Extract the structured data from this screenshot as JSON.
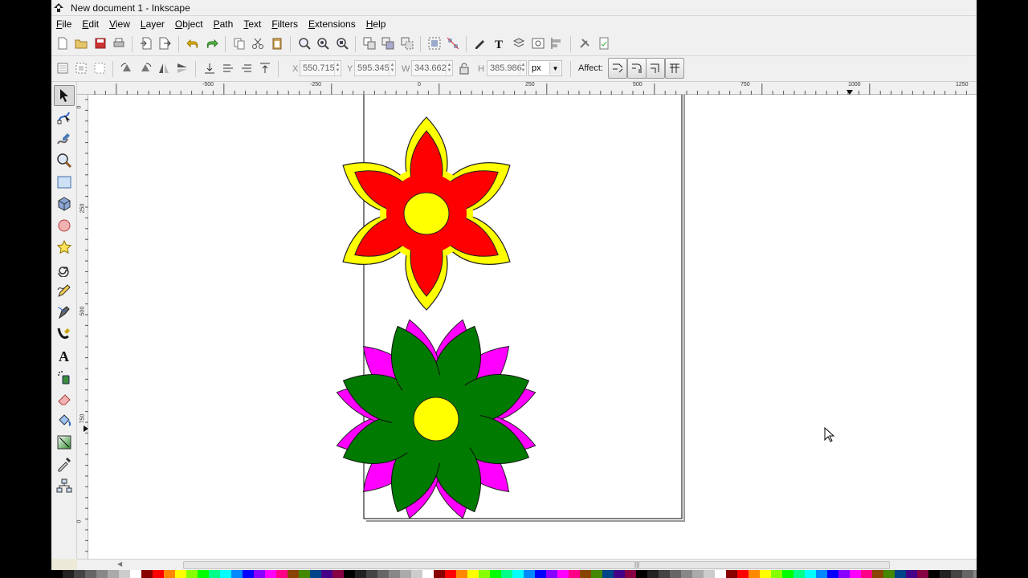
{
  "window": {
    "title": "New document 1 - Inkscape"
  },
  "menu": [
    "File",
    "Edit",
    "View",
    "Layer",
    "Object",
    "Path",
    "Text",
    "Filters",
    "Extensions",
    "Help"
  ],
  "selection": {
    "x_label": "X",
    "x_value": "550.715",
    "y_label": "Y",
    "y_value": "595.345",
    "w_label": "W",
    "w_value": "343.662",
    "h_label": "H",
    "h_value": "385.986",
    "unit": "px",
    "affect_label": "Affect:"
  },
  "ruler": {
    "h_labels": [
      "-500",
      "-250",
      "0",
      "250",
      "500",
      "750",
      "1000",
      "1250"
    ],
    "v_labels": [
      "0",
      "250",
      "500",
      "750",
      "1000",
      "0"
    ]
  },
  "tools": [
    "selector-tool",
    "node-tool",
    "tweak-tool",
    "zoom-tool",
    "rectangle-tool",
    "box-3d-tool",
    "ellipse-tool",
    "star-tool",
    "spiral-tool",
    "pencil-tool",
    "pen-tool",
    "calligraphy-tool",
    "text-tool",
    "spray-tool",
    "eraser-tool",
    "paint-bucket-tool",
    "gradient-tool",
    "dropper-tool",
    "connector-tool"
  ],
  "colors": {
    "flower1_outer": "#ffff00",
    "flower1_petals": "#ff0000",
    "flower1_center": "#ffff00",
    "flower2_back": "#ff00ff",
    "flower2_front": "#007a00",
    "flower2_center": "#ffff00"
  }
}
